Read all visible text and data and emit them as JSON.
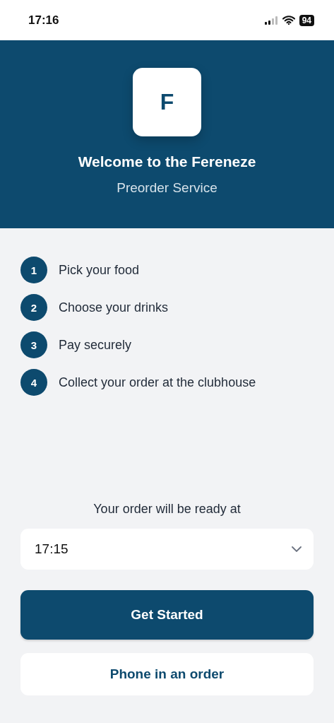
{
  "status_bar": {
    "time": "17:16",
    "battery": "94"
  },
  "header": {
    "logo_letter": "F",
    "title": "Welcome to the Fereneze",
    "subtitle": "Preorder Service"
  },
  "steps": [
    {
      "number": "1",
      "label": "Pick your food"
    },
    {
      "number": "2",
      "label": "Choose your drinks"
    },
    {
      "number": "3",
      "label": "Pay securely"
    },
    {
      "number": "4",
      "label": "Collect your order at the clubhouse"
    }
  ],
  "ready_label": "Your order will be ready at",
  "time_select": {
    "value": "17:15"
  },
  "buttons": [
    {
      "kind": "primary",
      "label": "Get Started"
    },
    {
      "kind": "secondary",
      "label": "Phone in an order"
    }
  ]
}
